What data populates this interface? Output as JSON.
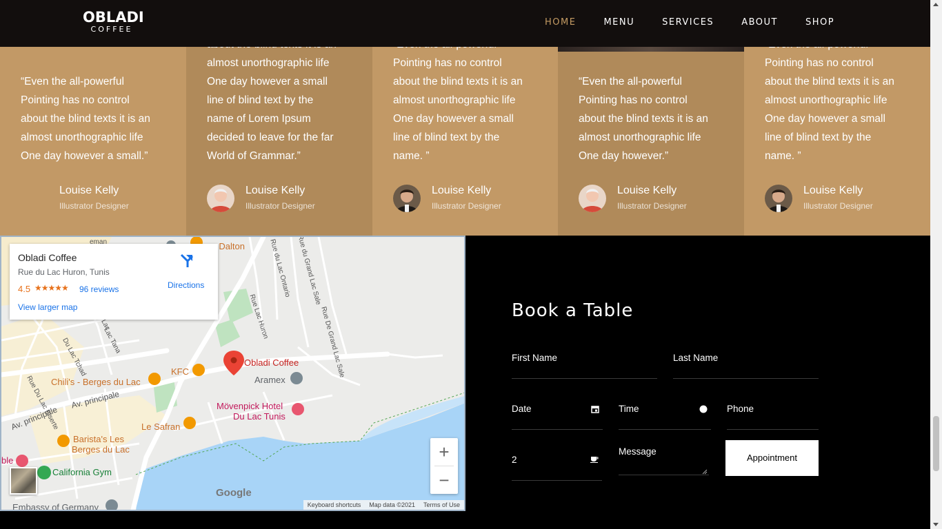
{
  "brand": {
    "line1": "OBLADI",
    "line2": "COFFEE"
  },
  "nav": {
    "items": [
      {
        "label": "HOME",
        "active": true
      },
      {
        "label": "MENU",
        "active": false
      },
      {
        "label": "SERVICES",
        "active": false
      },
      {
        "label": "ABOUT",
        "active": false
      },
      {
        "label": "SHOP",
        "active": false
      }
    ]
  },
  "colors": {
    "accent": "#c49b63",
    "testimonial_light": "#c29966",
    "testimonial_dark": "#b08a5a",
    "nav_bg": "#120e0d"
  },
  "testimonials": [
    {
      "lines": [
        "“Even the all-powerful",
        "Pointing has no control",
        "about the blind texts it is an",
        "almost unorthographic life",
        "One day however a small.”"
      ],
      "name": "Louise Kelly",
      "role": "Illustrator Designer",
      "avatar": "none"
    },
    {
      "lines": [
        "about the blind texts it is an",
        "almost unorthographic life",
        "One day however a small",
        "line of blind text by the",
        "name of Lorem Ipsum",
        "decided to leave for the far",
        "World of Grammar.”"
      ],
      "name": "Louise Kelly",
      "role": "Illustrator Designer",
      "avatar": "person-light"
    },
    {
      "lines": [
        "“Even the all-powerful",
        "Pointing has no control",
        "about the blind texts it is an",
        "almost unorthographic life",
        "One day however a small",
        "line of blind text by the",
        "name. ”"
      ],
      "name": "Louise Kelly",
      "role": "Illustrator Designer",
      "avatar": "person-dark"
    },
    {
      "lines": [
        "“Even the all-powerful",
        "Pointing has no control",
        "about the blind texts it is an",
        "almost unorthographic life",
        "One day however.”"
      ],
      "name": "Louise Kelly",
      "role": "Illustrator Designer",
      "avatar": "person-light"
    },
    {
      "lines": [
        "“Even the all-powerful",
        "Pointing has no control",
        "about the blind texts it is an",
        "almost unorthographic life",
        "One day however a small",
        "line of blind text by the",
        "name. ”"
      ],
      "name": "Louise Kelly",
      "role": "Illustrator Designer",
      "avatar": "person-dark"
    }
  ],
  "map": {
    "card": {
      "title": "Obladi Coffee",
      "address": "Rue du Lac Huron, Tunis",
      "rating": "4.5",
      "stars": "★★★★★",
      "reviews": "96 reviews",
      "larger": "View larger map",
      "directions": "Directions"
    },
    "pois": {
      "obladi": "Obladi Coffee",
      "dalton": "es Dalton",
      "kfc": "KFC",
      "chilis": "Chili's - Berges du Lac",
      "aramex": "Aramex",
      "movenpick1": "Mövenpick Hotel",
      "movenpick2": "Du Lac Tunis",
      "safran": "Le Safran",
      "barista1": "Barista's Les",
      "barista2": "Berges du Lac",
      "california": "California Gym",
      "embassy": "Embassy of Germany",
      "ble": "ble"
    },
    "streets": {
      "s1": "Rue du Lac Ontario",
      "s2": "Rue Lac Huron",
      "s3": "Rue du Grand Lac Sale",
      "s4": "Rue De Grand Lac Sale",
      "s5": "Av. principale",
      "s6": "Av. principale",
      "s7": "Rue Du Lac Biserte",
      "s8": "Du Lac Tchad",
      "s9": "Lac Tana",
      "s10": "Lac",
      "s11": "eman"
    },
    "zoom_in": "+",
    "zoom_out": "−",
    "logo": "Google",
    "attribution": [
      "Keyboard shortcuts",
      "Map data ©2021",
      "Terms of Use"
    ]
  },
  "booking": {
    "title": "Book a Table",
    "first_name": "First Name",
    "last_name": "Last Name",
    "date": "Date",
    "time": "Time",
    "phone": "Phone",
    "guests": "2",
    "message": "Message",
    "submit": "Appointment"
  }
}
